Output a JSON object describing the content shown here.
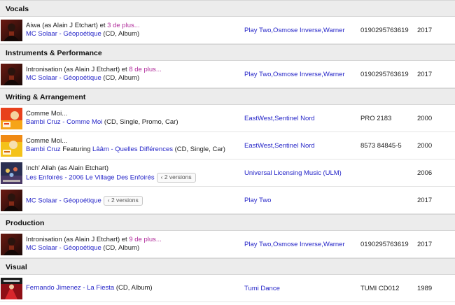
{
  "sections": [
    {
      "title": "Vocals",
      "rows": [
        {
          "thumb": "mc-solaar",
          "title": "Aiwa (as Alain J Etchart) et ",
          "more": "3 de plus...",
          "artist1": "MC Solaar",
          "sep1": " - ",
          "release": "Géopoétique",
          "format": " (CD, Album)",
          "labels": [
            "Play Two",
            "Osmose Inverse",
            "Warner"
          ],
          "catno": "0190295763619",
          "year": "2017"
        }
      ]
    },
    {
      "title": "Instruments & Performance",
      "rows": [
        {
          "thumb": "mc-solaar",
          "title": "Intronisation (as Alain J Etchart) et ",
          "more": "8 de plus...",
          "artist1": "MC Solaar",
          "sep1": " - ",
          "release": "Géopoétique",
          "format": " (CD, Album)",
          "labels": [
            "Play Two",
            "Osmose Inverse",
            "Warner"
          ],
          "catno": "0190295763619",
          "year": "2017"
        }
      ]
    },
    {
      "title": "Writing & Arrangement",
      "rows": [
        {
          "thumb": "bambi-red",
          "title": "Comme Moi...",
          "artist1": "Bambi Cruz",
          "sep1": " - ",
          "release": "Comme Moi",
          "format": " (CD, Single, Promo, Car)",
          "labels": [
            "EastWest",
            "Sentinel Nord"
          ],
          "catno": "PRO 2183",
          "year": "2000"
        },
        {
          "thumb": "bambi-yellow",
          "title": "Comme Moi...",
          "artist1": "Bambi Cruz",
          "featuring": " Featuring ",
          "artist2": "Lââm",
          "sep1": " - ",
          "release": "Quelles Différences",
          "format": " (CD, Single, Car)",
          "labels": [
            "EastWest",
            "Sentinel Nord"
          ],
          "catno": "8573 84845-5",
          "year": "2000"
        },
        {
          "thumb": "enfoires",
          "title": "Inch' Allah (as Alain Etchart)",
          "artist1": "Les Enfoirés",
          "sep1": " - ",
          "release": "2006 Le Village Des Enfoirés",
          "versions": "2 versions",
          "labels": [
            "Universal Licensing Music (ULM)"
          ],
          "catno": "",
          "year": "2006"
        },
        {
          "thumb": "mc-solaar",
          "single_line": true,
          "artist1": "MC Solaar",
          "sep1": " - ",
          "release": "Géopoétique",
          "versions": "2 versions",
          "labels": [
            "Play Two"
          ],
          "catno": "",
          "year": "2017"
        }
      ]
    },
    {
      "title": "Production",
      "rows": [
        {
          "thumb": "mc-solaar",
          "title": "Intronisation (as Alain J Etchart) et ",
          "more": "9 de plus...",
          "artist1": "MC Solaar",
          "sep1": " - ",
          "release": "Géopoétique",
          "format": " (CD, Album)",
          "labels": [
            "Play Two",
            "Osmose Inverse",
            "Warner"
          ],
          "catno": "0190295763619",
          "year": "2017"
        }
      ]
    },
    {
      "title": "Visual",
      "rows": [
        {
          "thumb": "fiesta",
          "single_line": true,
          "artist1": "Fernando Jimenez",
          "sep1": " - ",
          "release": "La Fiesta",
          "format": " (CD, Album)",
          "labels": [
            "Tumi Dance"
          ],
          "catno": "TUMI CD012",
          "year": "1989"
        }
      ]
    }
  ]
}
